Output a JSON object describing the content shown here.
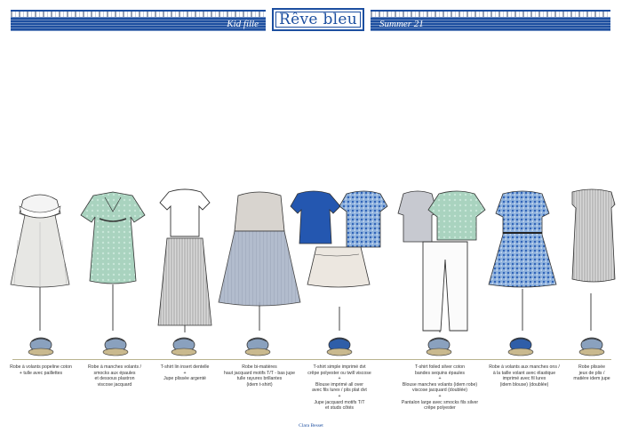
{
  "header": {
    "left_label": "Kid fille",
    "brand": "Rêve bleu",
    "right_label": "Summer 21",
    "color": "#1d4fa0"
  },
  "outfits": [
    {
      "id": 1,
      "caption": "Robe à volants popeline coton\n+ tulle avec paillettes"
    },
    {
      "id": 2,
      "caption": "Robe à manches volants /\nsmocks aux épaules\net dessous plastron\nviscose jacquard"
    },
    {
      "id": 3,
      "caption": "T-shirt lin insert dentelle\n+\nJupe plissée argenté"
    },
    {
      "id": 4,
      "caption": "Robe bi-matières\nhaut jacquard motifs T/T - bas jupe\ntulle rayures brillantes\n(idem t-shirt)"
    },
    {
      "id": 5,
      "caption": "T-shirt simple imprimé dvt\ncrêpe polyester ou twill viscose\n+\nBlouse imprimé all over\navec fils lurex / plis plat dvt\n+\nJupe jacquard motifs T/T\net studs côtés"
    },
    {
      "id": 6,
      "caption": "T-shirt foiled silver coton\nbandes sequins épaules\n+\nBlouse manches volants (idem robe)\nviscose jacquard (doublée)\n+\nPantalon large avec smocks fils silver\ncrêpe polyester"
    },
    {
      "id": 7,
      "caption": "Robe à volants aux manches ons /\nà la taille volant  avec élastique\nimprimé avec fil lurex\n(idem blouse) (doublée)"
    },
    {
      "id": 8,
      "caption": "Robe plissée\njeux de plis /\nmatière idem jupe"
    }
  ],
  "footer": {
    "text": "Clara Besset"
  }
}
